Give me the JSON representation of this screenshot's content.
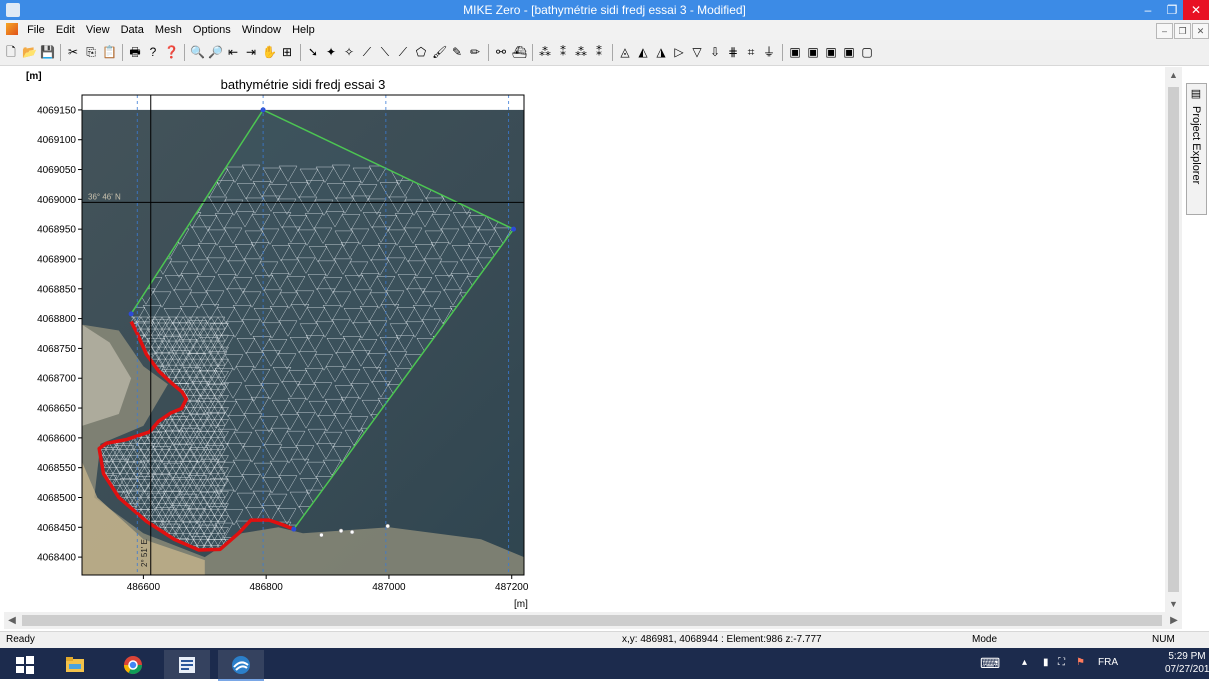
{
  "window": {
    "title": "MIKE Zero - [bathymétrie sidi fredj essai 3 - Modified]",
    "minimize_glyph": "–",
    "restore_glyph": "❐",
    "close_glyph": "✕"
  },
  "menubar": {
    "items": [
      "File",
      "Edit",
      "View",
      "Data",
      "Mesh",
      "Options",
      "Window",
      "Help"
    ],
    "mdi_minimize_glyph": "–",
    "mdi_restore_glyph": "❐",
    "mdi_close_glyph": "✕"
  },
  "toolbar": {
    "icons": [
      {
        "name": "new-file-icon",
        "glyph": "🗋"
      },
      {
        "name": "open-folder-icon",
        "glyph": "📂"
      },
      {
        "name": "save-icon",
        "glyph": "💾"
      },
      {
        "name": "cut-icon",
        "glyph": "✂"
      },
      {
        "name": "copy-icon",
        "glyph": "⎘"
      },
      {
        "name": "paste-icon",
        "glyph": "📋"
      },
      {
        "name": "print-icon",
        "glyph": "🖶"
      },
      {
        "name": "help-icon",
        "glyph": "?"
      },
      {
        "name": "context-help-icon",
        "glyph": "❓"
      },
      {
        "name": "zoom-in-icon",
        "glyph": "🔍"
      },
      {
        "name": "zoom-out-icon",
        "glyph": "🔎"
      },
      {
        "name": "zoom-previous-icon",
        "glyph": "⇤"
      },
      {
        "name": "zoom-next-icon",
        "glyph": "⇥"
      },
      {
        "name": "pan-icon",
        "glyph": "✋"
      },
      {
        "name": "zoom-extent-icon",
        "glyph": "⊞"
      },
      {
        "name": "select-arrow-icon",
        "glyph": "➘"
      },
      {
        "name": "move-vertex-icon",
        "glyph": "✦"
      },
      {
        "name": "insert-vertex-icon",
        "glyph": "✧"
      },
      {
        "name": "draw-arc-icon",
        "glyph": "⟋"
      },
      {
        "name": "draw-polyline-icon",
        "glyph": "⟍"
      },
      {
        "name": "draw-line-icon",
        "glyph": "⟋"
      },
      {
        "name": "polygon-icon",
        "glyph": "⬠"
      },
      {
        "name": "brush-icon",
        "glyph": "🖌"
      },
      {
        "name": "smooth-icon",
        "glyph": "✎"
      },
      {
        "name": "pencil-icon",
        "glyph": "✏"
      },
      {
        "name": "binoculars-icon",
        "glyph": "⚯"
      },
      {
        "name": "boat-icon",
        "glyph": "⛴"
      },
      {
        "name": "mesh-node-icon",
        "glyph": "⁂"
      },
      {
        "name": "mesh-edit-icon",
        "glyph": "⁑"
      },
      {
        "name": "mesh-delete-icon",
        "glyph": "⁂"
      },
      {
        "name": "mesh-info-icon",
        "glyph": "⁑"
      },
      {
        "name": "triangulate-icon",
        "glyph": "◬"
      },
      {
        "name": "refine-icon",
        "glyph": "◭"
      },
      {
        "name": "smooth-mesh-icon",
        "glyph": "◮"
      },
      {
        "name": "analyze-icon",
        "glyph": "▷"
      },
      {
        "name": "interpolate-icon",
        "glyph": "▽"
      },
      {
        "name": "export-icon",
        "glyph": "⇩"
      },
      {
        "name": "quality-icon",
        "glyph": "⋕"
      },
      {
        "name": "graph-icon",
        "glyph": "⌗"
      },
      {
        "name": "filter-icon",
        "glyph": "⏚"
      },
      {
        "name": "layer-1-icon",
        "glyph": "▣"
      },
      {
        "name": "layer-2-icon",
        "glyph": "▣"
      },
      {
        "name": "layer-3-icon",
        "glyph": "▣"
      },
      {
        "name": "layer-4-icon",
        "glyph": "▣"
      },
      {
        "name": "layer-5-icon",
        "glyph": "▢"
      }
    ]
  },
  "chart_data": {
    "type": "scatter",
    "title": "bathymétrie sidi fredj essai 3",
    "xlabel": "[m]",
    "ylabel": "[m]",
    "xlim": [
      486500,
      487220
    ],
    "ylim": [
      4068370,
      4069175
    ],
    "xticks": [
      486600,
      486800,
      487000,
      487200
    ],
    "yticks": [
      4068400,
      4068450,
      4068500,
      4068550,
      4068600,
      4068650,
      4068700,
      4068750,
      4068800,
      4068850,
      4068900,
      4068950,
      4069000,
      4069050,
      4069100,
      4069150
    ],
    "graticule": {
      "latitude_label": "36° 46' N",
      "latitude_y": 4068995,
      "longitude_label": "2° 51' E",
      "longitude_x": 486612,
      "dashed_x": [
        486590,
        486795,
        486995,
        487195
      ]
    },
    "open_boundary": [
      [
        486580,
        4068808
      ],
      [
        486795,
        4069150
      ],
      [
        487203,
        4068950
      ],
      [
        486845,
        4068447
      ]
    ],
    "land_boundary": [
      [
        486580,
        4068795
      ],
      [
        486590,
        4068775
      ],
      [
        486605,
        4068740
      ],
      [
        486625,
        4068712
      ],
      [
        486648,
        4068690
      ],
      [
        486663,
        4068677
      ],
      [
        486670,
        4068665
      ],
      [
        486662,
        4068649
      ],
      [
        486645,
        4068642
      ],
      [
        486625,
        4068628
      ],
      [
        486610,
        4068610
      ],
      [
        486572,
        4068597
      ],
      [
        486540,
        4068591
      ],
      [
        486528,
        4068582
      ],
      [
        486535,
        4068540
      ],
      [
        486560,
        4068500
      ],
      [
        486605,
        4068460
      ],
      [
        486650,
        4068430
      ],
      [
        486690,
        4068412
      ],
      [
        486725,
        4068413
      ],
      [
        486755,
        4068440
      ],
      [
        486775,
        4068462
      ],
      [
        486805,
        4068462
      ],
      [
        486825,
        4068455
      ],
      [
        486845,
        4068447
      ]
    ],
    "nodes": [
      [
        486580,
        4068808
      ],
      [
        486795,
        4069150
      ],
      [
        487203,
        4068950
      ],
      [
        486845,
        4068447
      ]
    ],
    "breakwater_points": [
      [
        486890,
        4068437
      ],
      [
        486922,
        4068444
      ],
      [
        486940,
        4068442
      ],
      [
        486998,
        4068452
      ]
    ],
    "cursor": {
      "x": 486981,
      "y": 4068944
    }
  },
  "status": {
    "ready": "Ready",
    "coords": "x,y: 486981, 4068944 :  Element:986  z:-7.777",
    "mode": "Mode",
    "num": "NUM"
  },
  "explorer": {
    "label": "Project Explorer",
    "icon_glyph": "▤"
  },
  "taskbar": {
    "lang": "FRA",
    "time": "5:29 PM",
    "date": "07/27/2017",
    "tray_chevron": "▴",
    "pin_glyph": "⛶",
    "keyboard_glyph": "⌨",
    "notify_glyph": "▮",
    "flag_glyph": "⚑"
  },
  "scroll": {
    "up": "▲",
    "down": "▼",
    "left": "◀",
    "right": "▶"
  }
}
